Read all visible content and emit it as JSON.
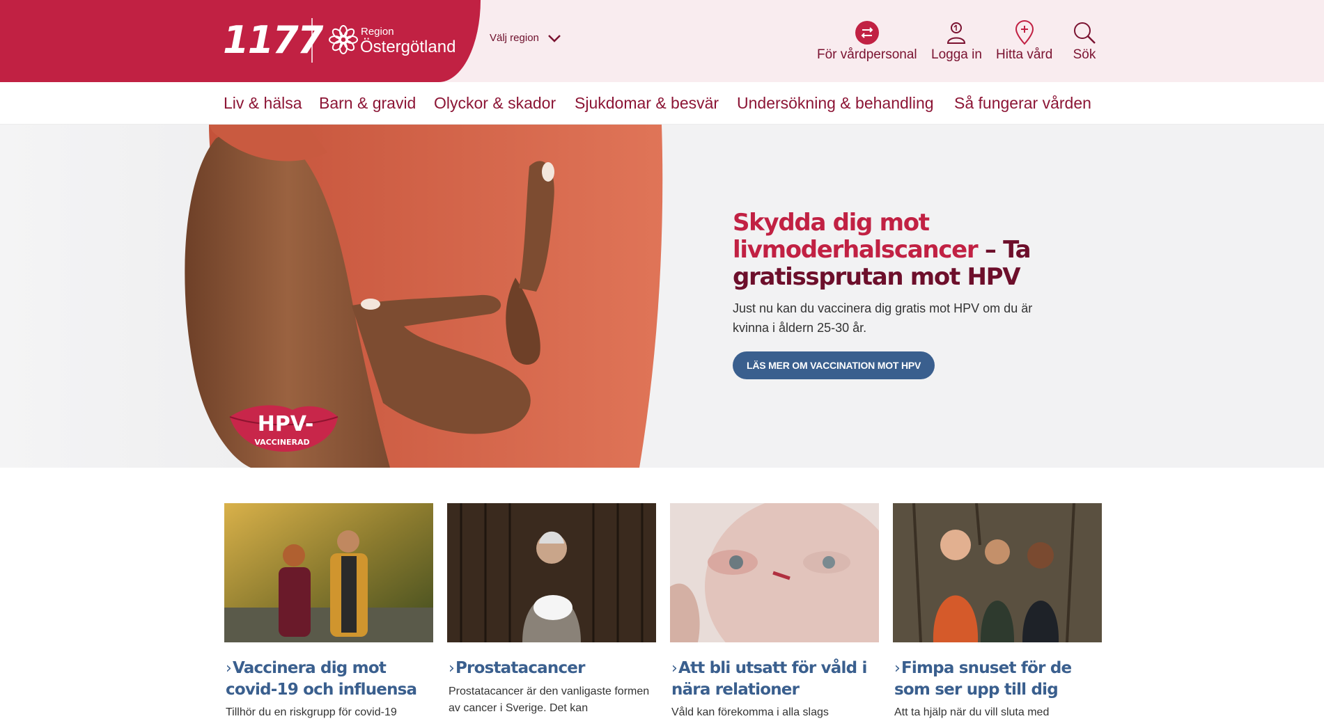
{
  "header": {
    "logo_text": "1177",
    "region_small": "Region",
    "region_name": "Östergötland",
    "region_select_label": "Välj region",
    "utilities": [
      {
        "label": "För vårdpersonal",
        "icon": "swap-arrows-icon"
      },
      {
        "label": "Logga in",
        "icon": "user-icon"
      },
      {
        "label": "Hitta vård",
        "icon": "location-pin-plus-icon"
      },
      {
        "label": "Sök",
        "icon": "search-icon"
      }
    ],
    "colors": {
      "brand": "#c12143",
      "header_bg": "#f9ecef",
      "link": "#8c1535"
    }
  },
  "nav": {
    "items": [
      "Liv & hälsa",
      "Barn & gravid",
      "Olyckor & skador",
      "Sjukdomar & besvär",
      "Undersökning & behandling",
      "Så fungerar vården"
    ]
  },
  "hero": {
    "title_accent": "Skydda dig mot livmoderhalscancer",
    "title_rest": " – Ta gratissprutan mot HPV",
    "lead": "Just nu kan du vaccinera dig gratis mot HPV om du är kvinna i åldern 25-30 år.",
    "cta": "LÄS MER OM VACCINATION MOT HPV",
    "sticker_line1": "HPV-",
    "sticker_line2": "VACCINERAD",
    "cta_color": "#3a5f8e"
  },
  "cards": [
    {
      "title": "Vaccinera dig mot covid-19 och influensa",
      "text": "Tillhör du en riskgrupp för covid-19"
    },
    {
      "title": "Prostatacancer",
      "text": "Prostatacancer är den vanligaste formen av cancer i Sverige. Det kan"
    },
    {
      "title": "Att bli utsatt för våld i nära relationer",
      "text": "Våld kan förekomma i alla slags"
    },
    {
      "title": "Fimpa snuset för de som ser upp till dig",
      "text": "Att ta hjälp när du vill sluta med"
    }
  ]
}
